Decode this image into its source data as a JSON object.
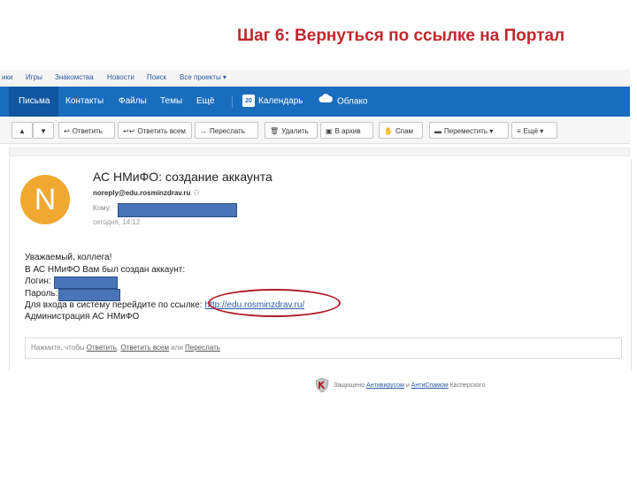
{
  "slide": {
    "title": "Шаг 6: Вернуться по ссылке на Портал"
  },
  "portal_nav": [
    "ики",
    "Игры",
    "Знакомства",
    "Новости",
    "Поиск",
    "Все проекты ▾"
  ],
  "mail_menu": {
    "items": [
      "Письма",
      "Контакты",
      "Файлы",
      "Темы",
      "Ещё"
    ],
    "calendar_label": "Календарь",
    "calendar_day": "20",
    "cloud_label": "Облако"
  },
  "toolbar": {
    "up": "▲",
    "down": "▼",
    "reply": "Ответить",
    "reply_all": "Ответить всем",
    "forward": "Переслать",
    "delete": "Удалить",
    "archive": "В архив",
    "spam": "Спам",
    "move": "Переместить ▾",
    "more": "Ещё ▾"
  },
  "message": {
    "avatar_letter": "N",
    "subject": "АС НМиФО: создание аккаунта",
    "from": "noreply@edu.rosminzdrav.ru",
    "to_label": "Кому:",
    "date": "сегодня, 14:12",
    "body": {
      "greeting": "Уважаемый, коллега!",
      "line1": "В АС НМиФО Вам был создан аккаунт:",
      "login_label": "Логин:",
      "password_label": "Пароль:",
      "link_intro": "Для входа в систему перейдите по ссылке:",
      "link": "http://edu.rosminzdrav.ru/",
      "signature": "Администрация АС НМиФО"
    },
    "reply": {
      "prefix": "Нажмите, чтобы",
      "reply": "Ответить",
      "reply_all": "Ответить всем",
      "or": "или",
      "forward": "Переслать"
    }
  },
  "protection": {
    "prefix": "Защищено",
    "antivirus": "Антивирусом",
    "and": "и",
    "antispam": "АнтиСпамом",
    "vendor": "Касперского"
  },
  "colors": {
    "mail_blue": "#1a6cbd",
    "avatar": "#f0a830",
    "slide_title": "#c0272d",
    "redaction": "#4a74b8",
    "annotation": "#b01c2a"
  }
}
